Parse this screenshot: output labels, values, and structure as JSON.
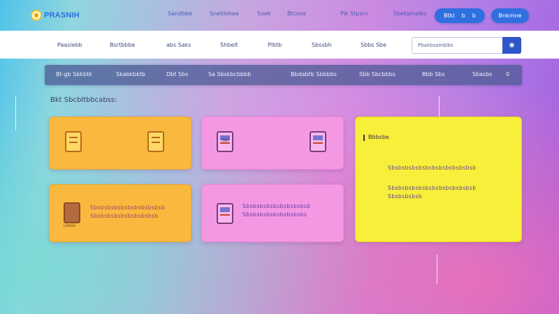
{
  "header": {
    "brand_name": "PRASNIH",
    "nav": [
      "Sandbbe",
      "Sneklohee",
      "Soek",
      "Btcose",
      "Plk Stpsm",
      "Sbetamalbs"
    ],
    "pill_1": [
      "Btkl",
      "b",
      "b"
    ],
    "pill_2": "Bnkmne"
  },
  "subnav": {
    "items": [
      "Paaslebb",
      "Bsrtbbbe",
      "abs Saks",
      "Shbelt",
      "Plbtb",
      "Sbssbh",
      "Sbbs Sbe"
    ],
    "search_placeholder": "Pbakbsamblbs"
  },
  "menu": {
    "items": [
      "Bt-gb Sbkbtk",
      "Skabkbktb",
      "Dbt Sbs",
      "Sa Sbskbcbbbb",
      "Bbdabtb Sbbbbs",
      "Sbb Sbcbbbs",
      "Bbb Sbs",
      "Sbasbs",
      "0"
    ]
  },
  "section_heading": "Bkt Sbcbltbbcabss:",
  "cards": {
    "c1_icon_left": "tag-icon",
    "c1_icon_right": "tag-icon",
    "c2_icon_label": "Sbl",
    "c2_icon_right": "document-icon",
    "c3_icon_label": "Lbsse",
    "c3_text": [
      "Sbsbsbsbsbsbsbsbsbsbsb",
      "Sbsbsbsbsbsbsbsbsbsb"
    ],
    "c4_text": [
      "Sbsbsbsbsbsbsbsbsbsb",
      "Sbsbsbsbsbsbsbsbsbs"
    ],
    "c5_title": "Bbbsbe",
    "c5_text": [
      "Sbsbsbsbsbsbsbsbsbsbsbsbsb",
      "Sbsbsbsbsbsbsbsbsbsbsbsbsb",
      "Sbsbsbsbsb"
    ]
  },
  "colors": {
    "accent_blue": "#2f6fe0",
    "card_orange": "#f8b93e",
    "card_pink": "#f598e4",
    "card_yellow": "#f7ef3a"
  }
}
